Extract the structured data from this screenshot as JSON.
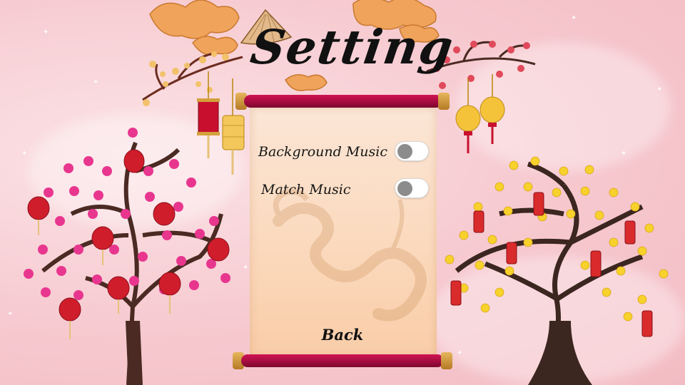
{
  "screen": {
    "title": "Setting",
    "theme_colors": {
      "background": "#f6c9cf",
      "scroll_paper": "#fbd8bb",
      "scroll_rod": "#a10b3d",
      "toggle_track": "#ffffff",
      "toggle_knob": "#8c8c8c"
    }
  },
  "settings": {
    "background_music": {
      "label": "Background Music",
      "enabled": false
    },
    "match_music": {
      "label": "Match Music",
      "enabled": false
    }
  },
  "actions": {
    "back_label": "Back"
  },
  "decor": {
    "left_tree": "pink-blossom-tree-with-red-lanterns",
    "right_tree": "yellow-apricot-blossom-tree-with-firecrackers",
    "top_left": "golden-clouds-with-plum-branch-and-lanterns",
    "top_right": "golden-clouds-with-plum-branch-and-yellow-lanterns",
    "hat": "conical-hat-icon",
    "watermark": "dragon-watermark"
  }
}
